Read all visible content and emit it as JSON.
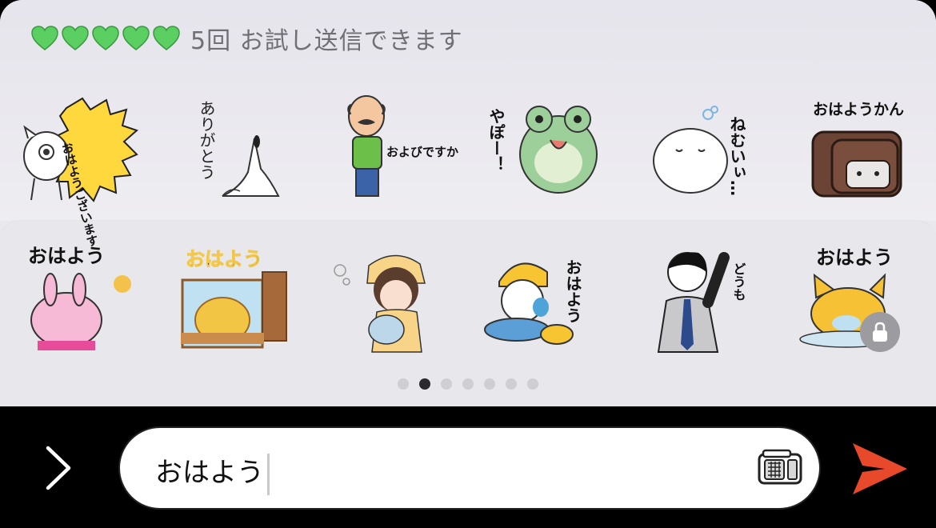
{
  "trial": {
    "hearts": [
      "green-heart",
      "green-heart",
      "green-heart",
      "green-heart",
      "green-heart"
    ],
    "heart_color": "#5ccf63",
    "text": "5回 お試し送信できます"
  },
  "stickers_row1": [
    {
      "name": "cat-ohayou-gozaimasu",
      "text": "おはようございます"
    },
    {
      "name": "arigatou-ghost",
      "text": "ありがとう"
    },
    {
      "name": "bald-man-oyobidesuka",
      "text": "およびですか"
    },
    {
      "name": "frog-yapo",
      "text": "やぽー！"
    },
    {
      "name": "white-blob-nemui",
      "text": "ねむいぃ…"
    },
    {
      "name": "ohayoukan",
      "text": "おはようかん"
    }
  ],
  "stickers_row2": [
    {
      "name": "pink-rabbit-ohayou",
      "text": "おはよう"
    },
    {
      "name": "pooh-ohayou",
      "text": "おはよう"
    },
    {
      "name": "sleepy-girl",
      "text": ""
    },
    {
      "name": "snowman-ohayou",
      "text": "おはよう"
    },
    {
      "name": "salaryman-doumo",
      "text": "どうも"
    },
    {
      "name": "fox-ohayou",
      "text": "おはよう"
    }
  ],
  "pagination": {
    "count": 7,
    "active_index": 1
  },
  "input": {
    "value": "おはよう"
  },
  "colors": {
    "send": "#e8492a",
    "accent_green": "#5ccf63"
  },
  "icons": {
    "expand": "chevron-right-icon",
    "sticker": "sticker-icon",
    "send": "send-icon",
    "lock": "lock-icon"
  }
}
